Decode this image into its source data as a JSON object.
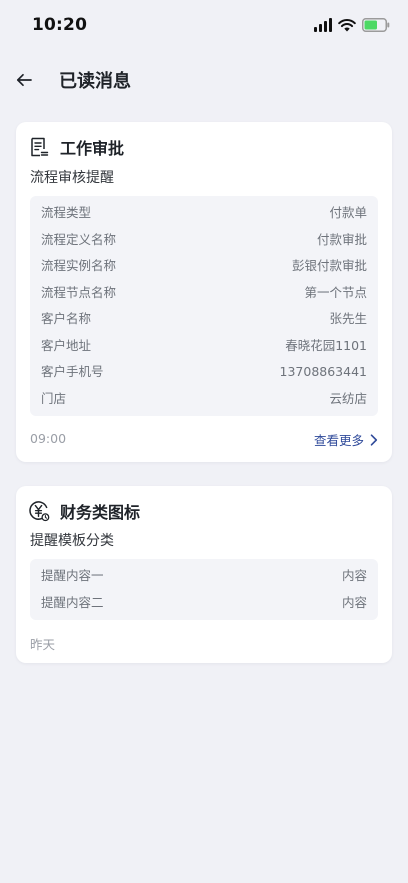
{
  "status_bar": {
    "time": "10:20",
    "battery_color": "#4cd964",
    "icons": [
      "signal-icon",
      "wifi-icon",
      "battery-icon"
    ]
  },
  "header": {
    "title": "已读消息",
    "back_icon": "arrow-left-icon"
  },
  "cards": [
    {
      "icon": "document-list-icon",
      "title": "工作审批",
      "subtitle": "流程审核提醒",
      "rows": [
        {
          "key": "流程类型",
          "value": "付款单"
        },
        {
          "key": "流程定义名称",
          "value": "付款审批"
        },
        {
          "key": "流程实例名称",
          "value": "彭银付款审批"
        },
        {
          "key": "流程节点名称",
          "value": "第一个节点"
        },
        {
          "key": "客户名称",
          "value": "张先生"
        },
        {
          "key": "客户地址",
          "value": "春晓花园1101"
        },
        {
          "key": "客户手机号",
          "value": "13708863441"
        },
        {
          "key": "门店",
          "value": "云纺店"
        }
      ],
      "time": "09:00",
      "more_label": "查看更多",
      "more_icon": "chevron-right-icon",
      "link_color": "#2f4a9a"
    },
    {
      "icon": "yuan-coin-icon",
      "title": "财务类图标",
      "subtitle": "提醒模板分类",
      "rows": [
        {
          "key": "提醒内容一",
          "value": "内容"
        },
        {
          "key": "提醒内容二",
          "value": "内容"
        }
      ],
      "time": "昨天"
    }
  ]
}
